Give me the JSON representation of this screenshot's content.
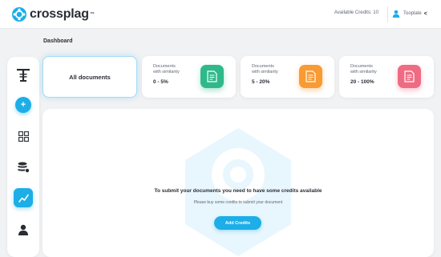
{
  "brand": {
    "name": "crossplag",
    "trademark": "™"
  },
  "header": {
    "credits_text": "Available Credits: 10",
    "user_name": "Tooplate",
    "user_chevron": "<"
  },
  "page": {
    "title": "Dashboard"
  },
  "sidebar": {
    "items": [
      {
        "icon": "text-tool-icon"
      },
      {
        "icon": "plus-icon",
        "label": "+"
      },
      {
        "icon": "grid-icon"
      },
      {
        "icon": "database-icon"
      },
      {
        "icon": "chart-line-icon",
        "active": true
      },
      {
        "icon": "user-icon"
      }
    ]
  },
  "cards": {
    "all_documents": "All documents",
    "stats": [
      {
        "label_line1": "Documents",
        "label_line2": "with similarity",
        "range": "0 - 5%",
        "color": "#2fb98b",
        "icon": "document-icon"
      },
      {
        "label_line1": "Documents",
        "label_line2": "with similarity",
        "range": "5 - 20%",
        "color": "#f99a33",
        "icon": "document-icon"
      },
      {
        "label_line1": "Documents",
        "label_line2": "with similarity",
        "range": "20 - 100%",
        "color": "#ef6b84",
        "icon": "document-icon"
      }
    ]
  },
  "empty_state": {
    "title": "To submit your documents you need to have some credits available",
    "subtitle": "Please buy some credits to submit your document",
    "button_label": "Add Credits"
  },
  "colors": {
    "accent": "#1daee8",
    "background": "#f1f2f4",
    "text_dark": "#2a2d34"
  }
}
